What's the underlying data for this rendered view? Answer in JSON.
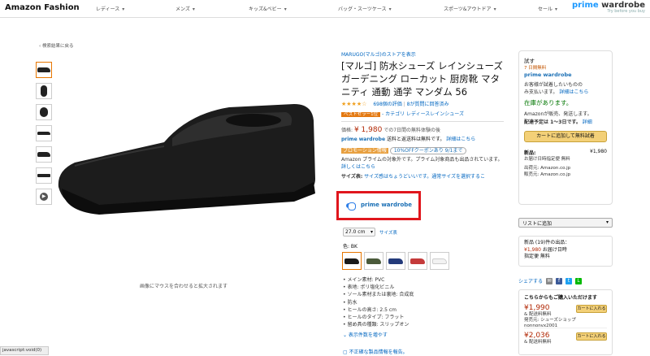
{
  "header": {
    "logo": "Amazon Fashion",
    "nav": [
      "レディース",
      "メンズ",
      "キッズ&ベビー",
      "バッグ・スーツケース",
      "スポーツ&アウトドア",
      "セール"
    ],
    "pw_logo_prime": "prime",
    "pw_logo_wardrobe": " wardrobe",
    "pw_tagline": "Try before you buy"
  },
  "back_link": "‹ 検索結果に戻る",
  "hover_hint": "画像にマウスを合わせると拡大されます",
  "product": {
    "store": "MARUGO(マルゴ)のストアを表示",
    "title": "[マルゴ] 防水シューズ レインシューズ ガーデニング ローカット 厨房靴 マタニティ 通動 通学 マンダム 56",
    "stars": "★★★★☆",
    "rating_text": "698個の評価",
    "qa": "8が質問に回答済み",
    "best_badge": "ベストセラー1位",
    "best_cat": "- カテゴリ レディースレインシューズ",
    "price_label": "価格:",
    "price": "¥ 1,980",
    "price_note": "での7日間の無料体験の後",
    "pw_label": "prime wardrobe",
    "pw_note": "送料と返送料は無料です。",
    "pw_link": "詳細はこちら",
    "promo_label": "プロモーション情報",
    "promo_coupon": "10%OFFクーポンあり 9/1まで",
    "prime_text": "Amazon プライムの対象外です。プライム対象商品も出品されています。",
    "prime_link": "詳しくはこちら",
    "size_label": "サイズ表:",
    "size_note": "サイズ感はちょうどいいです。通常サイズを選択するこ",
    "toggle_label": "prime wardrobe",
    "size_value": "27.0 cm",
    "size_guide": "サイズ表",
    "color_label": "色: BK",
    "bullets": [
      "メイン素材: PVC",
      "表地: ポリ塩化ビニル",
      "ソール素材または裏地: 合成底",
      "防水",
      "ヒールの高さ: 2.5 cm",
      "ヒールのタイプ: フラット",
      "留め具の種類: スリップオン"
    ],
    "more_link": "⌄ 表示件数を増やす",
    "report_link": "▢ 不正確な製品情報を報告。"
  },
  "swatch_colors": [
    "#1a1a1a",
    "#4a5a3a",
    "#233a7a",
    "#c43a3a",
    "#f2f2f2"
  ],
  "buybox": {
    "try": "試す",
    "free": "7 日間無料",
    "pw": "prime wardrobe",
    "desc": "お客様が試着したいものの",
    "desc2": "み支払います。",
    "detail_link": "詳細はこちら",
    "instock": "在庫があります。",
    "seller": "Amazonが販売、発送します。",
    "ship_label": "配達予定は 1〜3日です。",
    "ship_link": "詳細",
    "add_cart": "カートに追加して無料試着",
    "new_label": "新品:",
    "new_price": "¥1,980",
    "ship_free": "お届け日時指定便 無料",
    "ship_from": "出荷元: Amazon.co.jp",
    "sold_by": "販売元: Amazon.co.jp"
  },
  "wishlist": "リストに追加",
  "others": {
    "line1": "新品 (19)件の出品：",
    "price": "¥1,980",
    "line2": "お届け日時",
    "line3": "指定便 無料"
  },
  "share": "シェアする",
  "offers": {
    "header": "こちらからもご購入いただけます",
    "rows": [
      {
        "price": "¥1,990",
        "ship": "& 配送料無料",
        "seller": "発売元: シューズショップ",
        "id": "nonnonvx2001",
        "btn": "カートに入れる"
      },
      {
        "price": "¥2,036",
        "ship": "& 配送料無料",
        "seller": "",
        "id": "",
        "btn": "カートに入れる"
      }
    ]
  },
  "status": "javascript:void(0)"
}
